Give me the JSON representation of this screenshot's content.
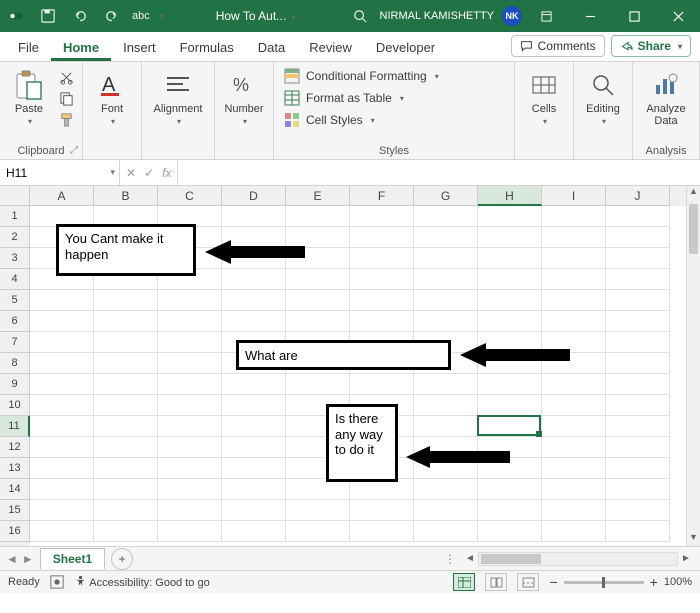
{
  "titlebar": {
    "autosave": "abc",
    "doc_title": "How To Aut...",
    "user_name": "NIRMAL KAMISHETTY",
    "user_initials": "NK"
  },
  "tabs": {
    "file": "File",
    "home": "Home",
    "insert": "Insert",
    "formulas": "Formulas",
    "data": "Data",
    "review": "Review",
    "developer": "Developer",
    "comments": "Comments",
    "share": "Share"
  },
  "ribbon": {
    "clipboard": {
      "paste": "Paste",
      "label": "Clipboard"
    },
    "font": {
      "btn": "Font"
    },
    "alignment": {
      "btn": "Alignment"
    },
    "number": {
      "btn": "Number"
    },
    "styles": {
      "cond_fmt": "Conditional Formatting",
      "fmt_table": "Format as Table",
      "cell_styles": "Cell Styles",
      "label": "Styles"
    },
    "cells": {
      "btn": "Cells"
    },
    "editing": {
      "btn": "Editing"
    },
    "analysis": {
      "btn": "Analyze Data",
      "label": "Analysis"
    }
  },
  "formula_bar": {
    "name_box": "H11",
    "fx": "fx",
    "formula": ""
  },
  "grid": {
    "columns": [
      "A",
      "B",
      "C",
      "D",
      "E",
      "F",
      "G",
      "H",
      "I",
      "J"
    ],
    "rows": [
      "1",
      "2",
      "3",
      "4",
      "5",
      "6",
      "7",
      "8",
      "9",
      "10",
      "11",
      "12",
      "13",
      "14",
      "15",
      "16"
    ],
    "selected_col": "H",
    "selected_row": "11"
  },
  "shapes": {
    "box1": "You Cant make it happen",
    "box2": "What are",
    "box3": "Is there any way to do it"
  },
  "sheetbar": {
    "sheet1": "Sheet1"
  },
  "statusbar": {
    "ready": "Ready",
    "accessibility": "Accessibility: Good to go",
    "zoom": "100%"
  }
}
